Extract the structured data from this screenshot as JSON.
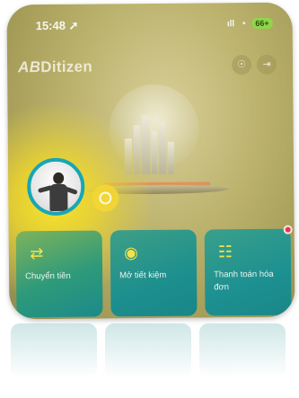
{
  "status_bar": {
    "time": "15:48",
    "location_arrow": "➚",
    "signal": "ıll",
    "wifi": "wifi-icon",
    "battery": "66+"
  },
  "header": {
    "logo_prefix": "AB",
    "logo_text": "Ditizen",
    "support_icon": "headset-icon",
    "logout_icon": "logout-icon"
  },
  "quick_actions": [
    {
      "label": "Chuyển tiền",
      "icon": "transfer-icon",
      "badge": false
    },
    {
      "label": "Mở tiết kiệm",
      "icon": "piggy-bank-icon",
      "badge": false
    },
    {
      "label": "Thanh toán hóa đơn",
      "icon": "bill-icon",
      "badge": true
    }
  ],
  "colors": {
    "accent_yellow": "#f5e24a",
    "avatar_ring": "#18a6b4",
    "card_teal": "#1d8f8e",
    "badge_red": "#e8345a"
  }
}
